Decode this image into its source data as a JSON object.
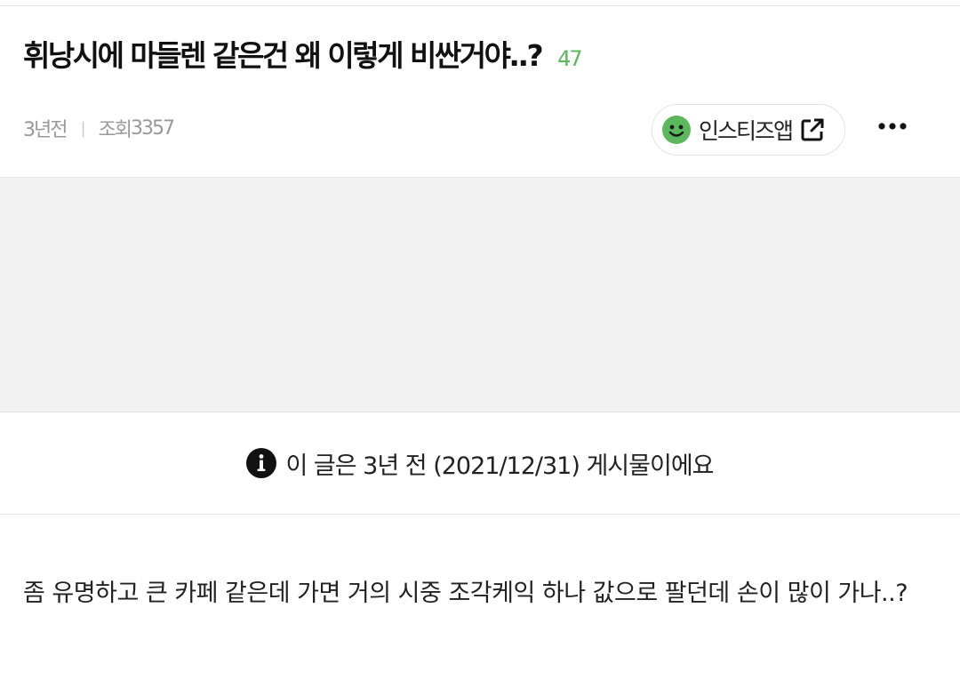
{
  "post": {
    "title": "휘낭시에 마들렌 같은건 왜 이렇게 비싼거야..?",
    "comment_count": "47",
    "time_ago": "3년전",
    "views_label": "조회",
    "views": "3357",
    "body": "좀 유명하고 큰 카페 같은데 가면 거의 시중 조각케익 하나 값으로 팔던데 손이 많이 가나..?"
  },
  "app_button": {
    "label": "인스티즈앱",
    "icon": "smile-icon",
    "ext_icon": "external-link-icon",
    "accent": "#5cb85c"
  },
  "more_menu": {
    "icon": "more-dots-icon"
  },
  "notice": {
    "icon": "info-icon",
    "text": "이 글은 3년 전 (2021/12/31) 게시물이에요"
  },
  "colors": {
    "comment_count": "#5cb85c",
    "meta": "#999999",
    "ad_bg": "#f2f2f2"
  }
}
